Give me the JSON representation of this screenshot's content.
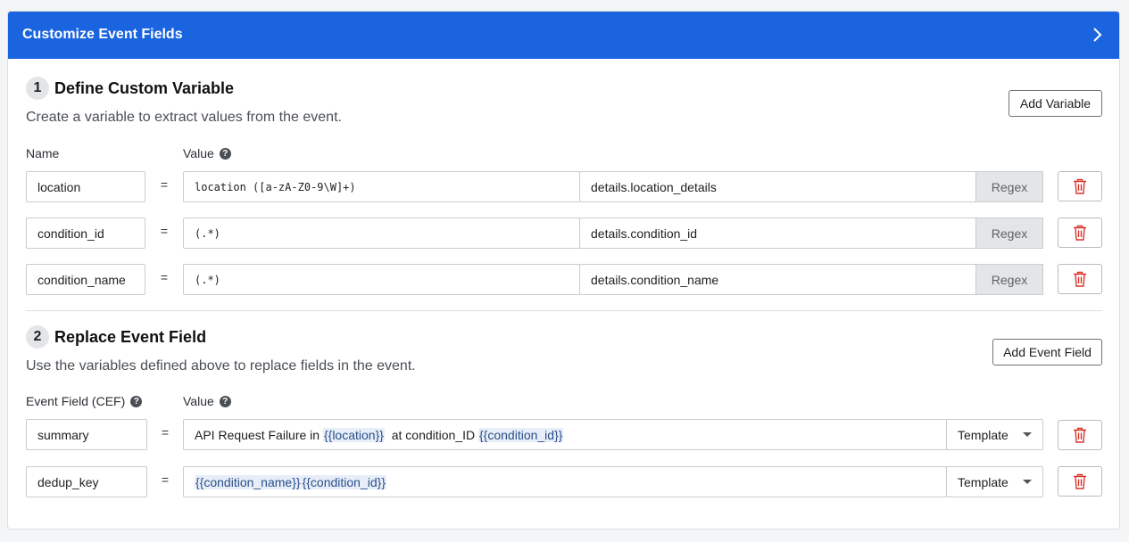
{
  "header": {
    "title": "Customize Event Fields"
  },
  "section1": {
    "step": "1",
    "title": "Define Custom Variable",
    "description": "Create a variable to extract values from the event.",
    "add_button": "Add Variable",
    "name_label": "Name",
    "value_label": "Value",
    "help_glyph": "?",
    "rows": [
      {
        "name": "location",
        "equals": "=",
        "pattern": "location ([a-zA-Z0-9\\W]+)",
        "path": "details.location_details",
        "type": "Regex"
      },
      {
        "name": "condition_id",
        "equals": "=",
        "pattern": "(.*)",
        "path": "details.condition_id",
        "type": "Regex"
      },
      {
        "name": "condition_name",
        "equals": "=",
        "pattern": "(.*)",
        "path": "details.condition_name",
        "type": "Regex"
      }
    ]
  },
  "section2": {
    "step": "2",
    "title": "Replace Event Field",
    "description": "Use the variables defined above to replace fields in the event.",
    "add_button": "Add Event Field",
    "field_label": "Event Field (CEF)",
    "value_label": "Value",
    "help_glyph": "?",
    "rows": [
      {
        "field": "summary",
        "equals": "=",
        "text1": "API Request Failure in ",
        "var1": "{{location}}",
        "text2": "  at condition_ID ",
        "var2": "{{condition_id}}",
        "type": "Template"
      },
      {
        "field": "dedup_key",
        "equals": "=",
        "text1": "",
        "var1": "{{condition_name}}",
        "text2": "",
        "var2": "{{condition_id}}",
        "type": "Template"
      }
    ]
  },
  "icons": {
    "collapse": "chevron-right-icon",
    "delete": "trash-icon",
    "help": "help-icon",
    "dropdown": "caret-down-icon"
  },
  "colors": {
    "header_bg": "#1a64e0",
    "trash": "#d9342b",
    "background": "#f4f5f6"
  }
}
